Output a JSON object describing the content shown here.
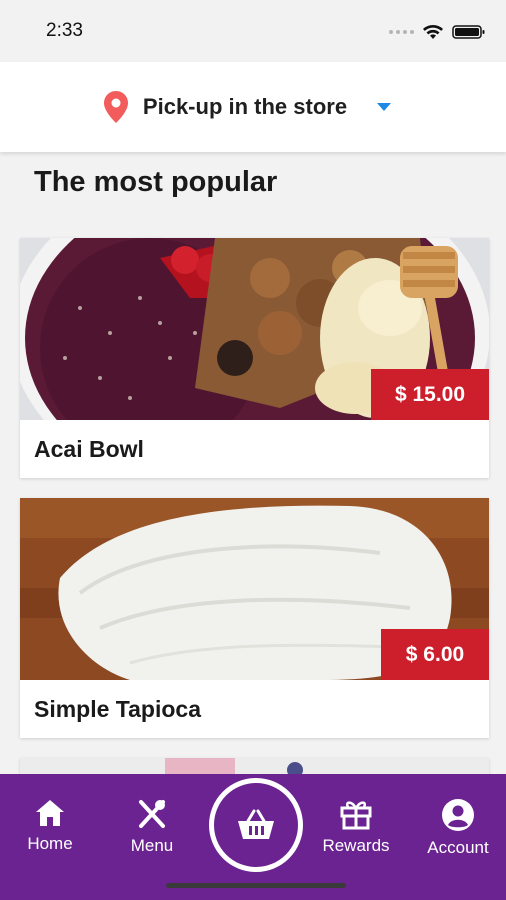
{
  "status_bar": {
    "time": "2:33"
  },
  "location": {
    "label": "Pick-up in the store",
    "pin_icon": "location-pin-icon",
    "accent": "#f25c5c",
    "dropdown_color": "#1e88e5"
  },
  "section": {
    "title": "The most popular"
  },
  "products": [
    {
      "name": "Acai Bowl",
      "price": "$ 15.00"
    },
    {
      "name": "Simple Tapioca",
      "price": "$ 6.00"
    }
  ],
  "nav": {
    "home": "Home",
    "menu": "Menu",
    "rewards": "Rewards",
    "account": "Account"
  },
  "colors": {
    "nav_bg": "#6b2391",
    "price_bg": "#cc1f2b"
  }
}
